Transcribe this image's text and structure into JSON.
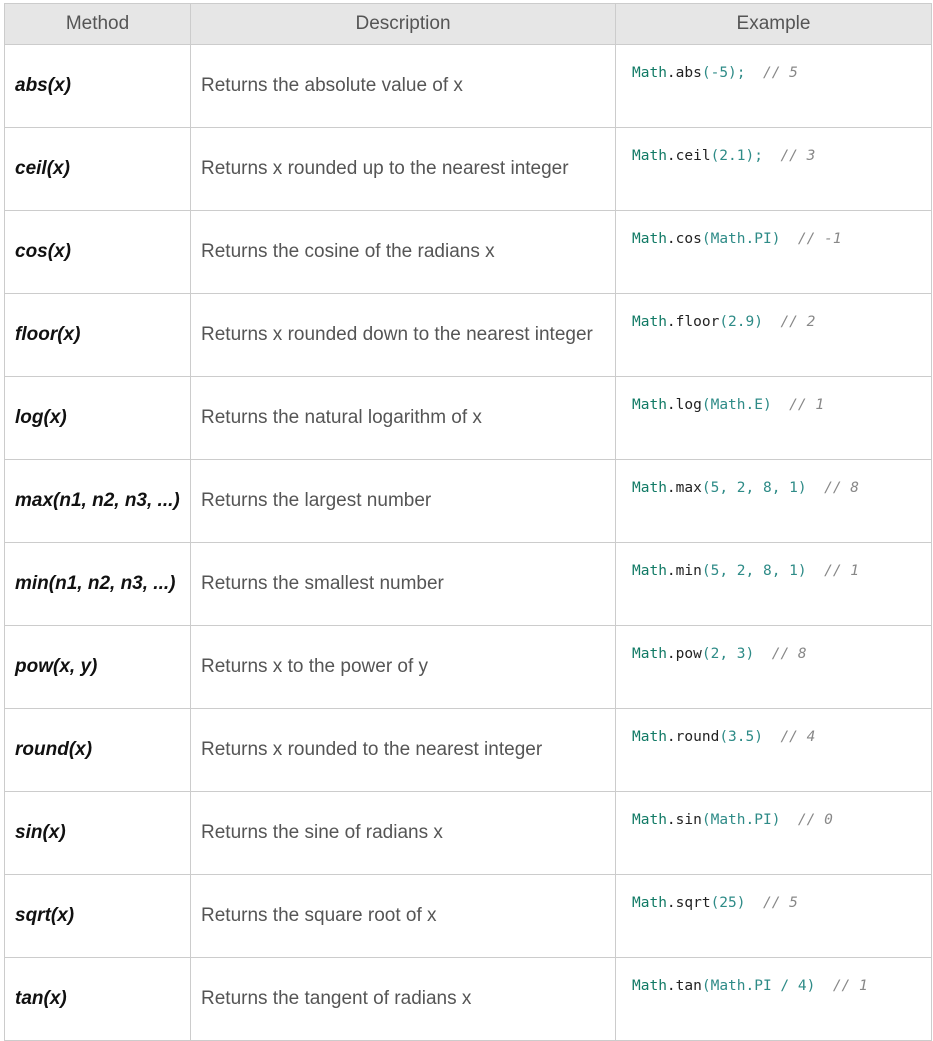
{
  "headers": {
    "method": "Method",
    "description": "Description",
    "example": "Example"
  },
  "rows": [
    {
      "method": "abs(x)",
      "description": "Returns the absolute value of x",
      "example": {
        "obj": "Math",
        "fn": "abs",
        "args": "(-5);",
        "comment": "// 5"
      }
    },
    {
      "method": "ceil(x)",
      "description": "Returns x rounded up to the nearest integer",
      "example": {
        "obj": "Math",
        "fn": "ceil",
        "args": "(2.1);",
        "comment": "// 3"
      }
    },
    {
      "method": "cos(x)",
      "description": "Returns the cosine of the radians x",
      "example": {
        "obj": "Math",
        "fn": "cos",
        "args": "(Math.PI)",
        "comment": "// -1"
      }
    },
    {
      "method": "floor(x)",
      "description": "Returns x rounded down to the nearest integer",
      "example": {
        "obj": "Math",
        "fn": "floor",
        "args": "(2.9)",
        "comment": "// 2"
      }
    },
    {
      "method": "log(x)",
      "description": "Returns the natural logarithm of x",
      "example": {
        "obj": "Math",
        "fn": "log",
        "args": "(Math.E)",
        "comment": "// 1"
      }
    },
    {
      "method": "max(n1, n2, n3, ...)",
      "description": "Returns the largest number",
      "example": {
        "obj": "Math",
        "fn": "max",
        "args": "(5, 2, 8, 1)",
        "comment": "// 8"
      }
    },
    {
      "method": "min(n1, n2, n3, ...)",
      "description": "Returns the smallest number",
      "example": {
        "obj": "Math",
        "fn": "min",
        "args": "(5, 2, 8, 1)",
        "comment": "// 1"
      }
    },
    {
      "method": "pow(x, y)",
      "description": "Returns x to the power of y",
      "example": {
        "obj": "Math",
        "fn": "pow",
        "args": "(2, 3)",
        "comment": "// 8"
      }
    },
    {
      "method": "round(x)",
      "description": "Returns x rounded to the nearest integer",
      "example": {
        "obj": "Math",
        "fn": "round",
        "args": "(3.5)",
        "comment": "// 4"
      }
    },
    {
      "method": "sin(x)",
      "description": "Returns the sine of radians x",
      "example": {
        "obj": "Math",
        "fn": "sin",
        "args": "(Math.PI)",
        "comment": "// 0"
      }
    },
    {
      "method": "sqrt(x)",
      "description": "Returns the square root of x",
      "example": {
        "obj": "Math",
        "fn": "sqrt",
        "args": "(25)",
        "comment": "// 5"
      }
    },
    {
      "method": "tan(x)",
      "description": "Returns the tangent of radians x",
      "example": {
        "obj": "Math",
        "fn": "tan",
        "args": "(Math.PI / 4)",
        "comment": "// 1"
      }
    }
  ]
}
